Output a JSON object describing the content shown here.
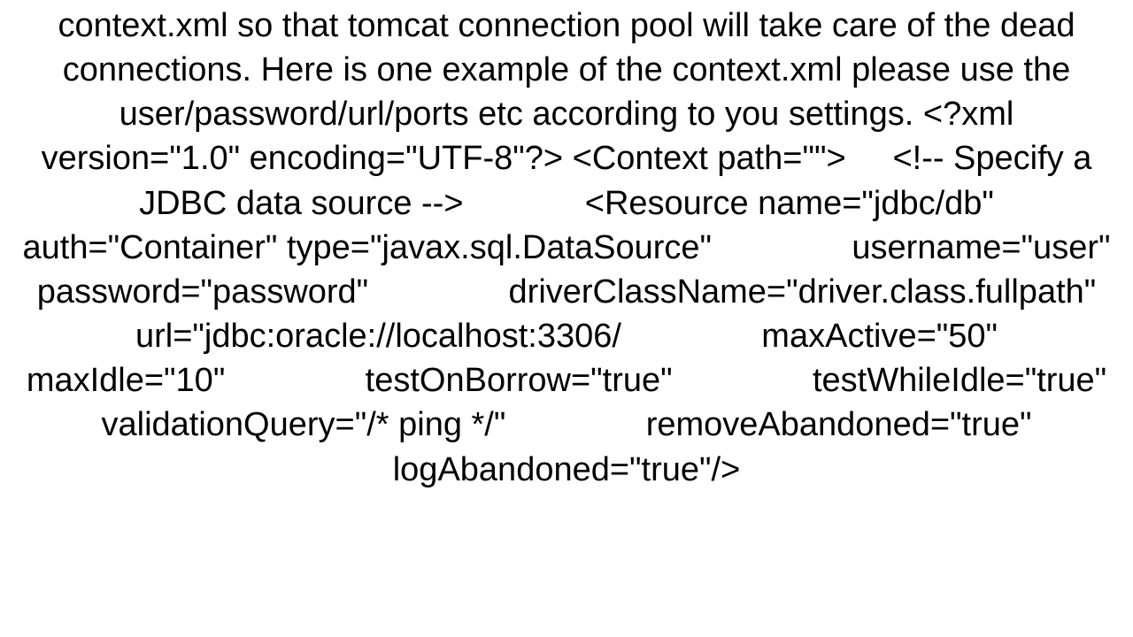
{
  "body_text": "context.xml so that tomcat connection pool will take care of the dead connections. Here is one example of the context.xml please use the user/password/url/ports etc according to you settings. <?xml version=\"1.0\" encoding=\"UTF-8\"?> <Context path=\"\">     <!-- Specify a JDBC data source -->             <Resource name=\"jdbc/db\" auth=\"Container\" type=\"javax.sql.DataSource\"               username=\"user\"               password=\"password\"               driverClassName=\"driver.class.fullpath\"               url=\"jdbc:oracle://localhost:3306/               maxActive=\"50\"               maxIdle=\"10\"               testOnBorrow=\"true\"               testWhileIdle=\"true\"               validationQuery=\"/* ping */\"               removeAbandoned=\"true\"               logAbandoned=\"true\"/>"
}
